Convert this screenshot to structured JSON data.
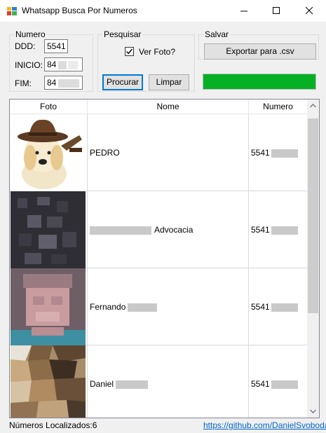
{
  "window": {
    "title": "Whatsapp Busca Por Numeros"
  },
  "numero_group": {
    "legend": "Numero",
    "ddd_label": "DDD:",
    "ddd_value": "5541",
    "inicio_label": "INICIO:",
    "inicio_value": "84",
    "fim_label": "FIM:",
    "fim_value": "84"
  },
  "pesquisar_group": {
    "legend": "Pesquisar",
    "ver_foto_label": "Ver Foto?",
    "ver_foto_checked": true,
    "procurar_label": "Procurar",
    "limpar_label": "Limpar"
  },
  "salvar_group": {
    "legend": "Salvar",
    "export_label": "Exportar para .csv"
  },
  "progress": {
    "fraction": 1.0,
    "color": "#06b025"
  },
  "grid": {
    "columns": [
      "Foto",
      "Nome",
      "Numero"
    ],
    "rows": [
      {
        "nome": "PEDRO",
        "numero": "5541"
      },
      {
        "nome": "Advocacia",
        "numero": "5541"
      },
      {
        "nome": "Fernando",
        "numero": "5541"
      },
      {
        "nome": "Daniel",
        "numero": "5541"
      }
    ]
  },
  "status": {
    "count_text": "Números Localizados:6",
    "link_text": "https://github.com/DanielSvoboda"
  }
}
